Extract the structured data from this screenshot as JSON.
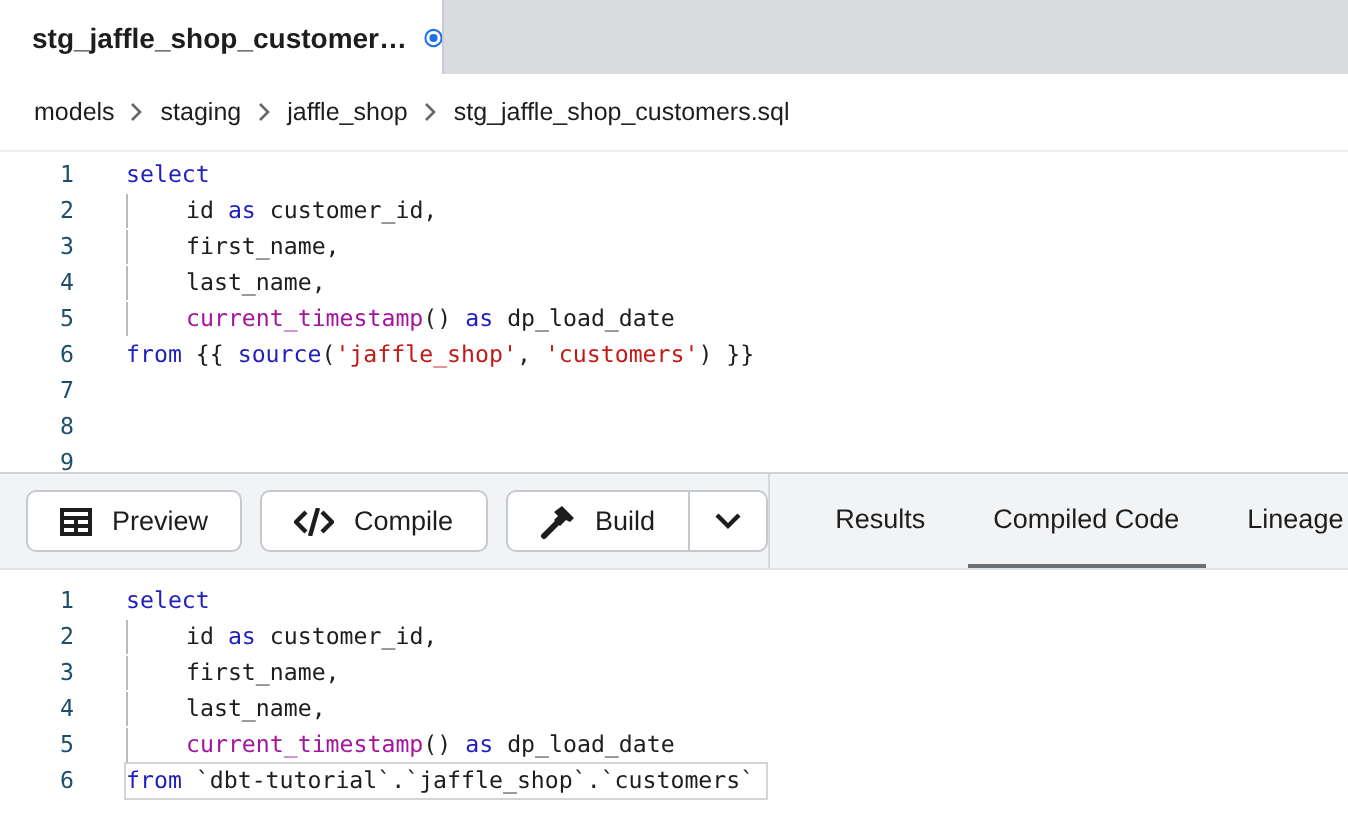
{
  "file_tab": {
    "title": "stg_jaffle_shop_customer…",
    "unsaved": true
  },
  "breadcrumb": [
    "models",
    "staging",
    "jaffle_shop",
    "stg_jaffle_shop_customers.sql"
  ],
  "editor": {
    "lines": [
      {
        "number": "1",
        "indent": false,
        "tokens": [
          {
            "kind": "keyword",
            "text": "select"
          }
        ]
      },
      {
        "number": "2",
        "indent": true,
        "tokens": [
          {
            "kind": "plain",
            "text": "id "
          },
          {
            "kind": "keyword",
            "text": "as"
          },
          {
            "kind": "plain",
            "text": " customer_id,"
          }
        ]
      },
      {
        "number": "3",
        "indent": true,
        "tokens": [
          {
            "kind": "plain",
            "text": "first_name,"
          }
        ]
      },
      {
        "number": "4",
        "indent": true,
        "tokens": [
          {
            "kind": "plain",
            "text": "last_name,"
          }
        ]
      },
      {
        "number": "5",
        "indent": true,
        "tokens": [
          {
            "kind": "function",
            "text": "current_timestamp"
          },
          {
            "kind": "plain",
            "text": "() "
          },
          {
            "kind": "keyword",
            "text": "as"
          },
          {
            "kind": "plain",
            "text": " dp_load_date"
          }
        ]
      },
      {
        "number": "6",
        "indent": false,
        "tokens": [
          {
            "kind": "keyword",
            "text": "from"
          },
          {
            "kind": "plain",
            "text": " {{ "
          },
          {
            "kind": "keyword",
            "text": "source"
          },
          {
            "kind": "plain",
            "text": "("
          },
          {
            "kind": "string",
            "text": "'jaffle_shop'"
          },
          {
            "kind": "plain",
            "text": ", "
          },
          {
            "kind": "string",
            "text": "'customers'"
          },
          {
            "kind": "plain",
            "text": ") }}"
          }
        ]
      },
      {
        "number": "7"
      },
      {
        "number": "8"
      },
      {
        "number": "9"
      }
    ]
  },
  "toolbar": {
    "buttons": [
      {
        "kind": "preview",
        "label": "Preview"
      },
      {
        "kind": "compile",
        "label": "Compile"
      },
      {
        "kind": "build",
        "label": "Build"
      }
    ],
    "tabs": [
      {
        "label": "Results",
        "selected": false
      },
      {
        "label": "Compiled Code",
        "selected": true
      },
      {
        "label": "Lineage",
        "selected": false
      }
    ]
  },
  "compiled": {
    "lines": [
      {
        "number": "1",
        "indent": false,
        "active": false,
        "tokens": [
          {
            "kind": "keyword",
            "text": "select"
          }
        ]
      },
      {
        "number": "2",
        "indent": true,
        "active": false,
        "tokens": [
          {
            "kind": "plain",
            "text": "id "
          },
          {
            "kind": "keyword",
            "text": "as"
          },
          {
            "kind": "plain",
            "text": " customer_id,"
          }
        ]
      },
      {
        "number": "3",
        "indent": true,
        "active": false,
        "tokens": [
          {
            "kind": "plain",
            "text": "first_name,"
          }
        ]
      },
      {
        "number": "4",
        "indent": true,
        "active": false,
        "tokens": [
          {
            "kind": "plain",
            "text": "last_name,"
          }
        ]
      },
      {
        "number": "5",
        "indent": true,
        "active": false,
        "tokens": [
          {
            "kind": "function",
            "text": "current_timestamp"
          },
          {
            "kind": "plain",
            "text": "() "
          },
          {
            "kind": "keyword",
            "text": "as"
          },
          {
            "kind": "plain",
            "text": " dp_load_date"
          }
        ]
      },
      {
        "number": "6",
        "indent": false,
        "active": true,
        "tokens": [
          {
            "kind": "keyword",
            "text": "from"
          },
          {
            "kind": "plain",
            "text": " `dbt-tutorial`.`jaffle_shop`.`customers`"
          }
        ]
      }
    ]
  }
}
